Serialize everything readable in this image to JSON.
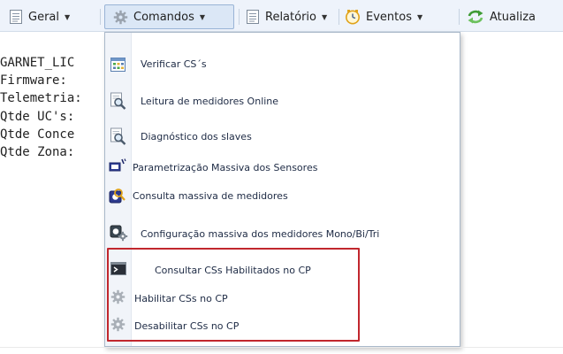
{
  "toolbar": {
    "items": [
      {
        "label": "Geral",
        "icon": "document-icon"
      },
      {
        "label": "Comandos",
        "icon": "gear-icon"
      },
      {
        "label": "Relatório",
        "icon": "document-icon"
      },
      {
        "label": "Eventos",
        "icon": "clock-icon"
      },
      {
        "label": "Atualiza",
        "icon": "refresh-icon"
      }
    ]
  },
  "info": {
    "lines": [
      "GARNET_LIC",
      "Firmware:",
      "Telemetria:",
      "Qtde UC's:",
      "Qtde Conce",
      "Qtde Zona:"
    ]
  },
  "menu": {
    "items": [
      {
        "label": "Verificar CS´s",
        "icon": "table-icon"
      },
      {
        "label": "Leitura de medidores Online",
        "icon": "magnifier-document-icon"
      },
      {
        "label": "Diagnóstico dos slaves",
        "icon": "magnifier-document-icon"
      },
      {
        "label": "Parametrização Massiva dos Sensores",
        "icon": "sensor-edit-icon"
      },
      {
        "label": "Consulta massiva de medidores",
        "icon": "meter-search-icon"
      },
      {
        "label": "Configuração massiva dos medidores Mono/Bi/Tri",
        "icon": "meter-config-icon"
      },
      {
        "label": "Consultar CSs Habilitados no CP",
        "icon": "terminal-icon"
      },
      {
        "label": "Habilitar CSs no CP",
        "icon": "gear-icon"
      },
      {
        "label": "Desabilitar CSs no CP",
        "icon": "gear-icon"
      }
    ]
  },
  "colors": {
    "toolbar_bg": "#eef3fb",
    "active_bg": "#dbe7f6",
    "highlight_border": "#c1272d",
    "menu_text": "#1d2a44"
  }
}
